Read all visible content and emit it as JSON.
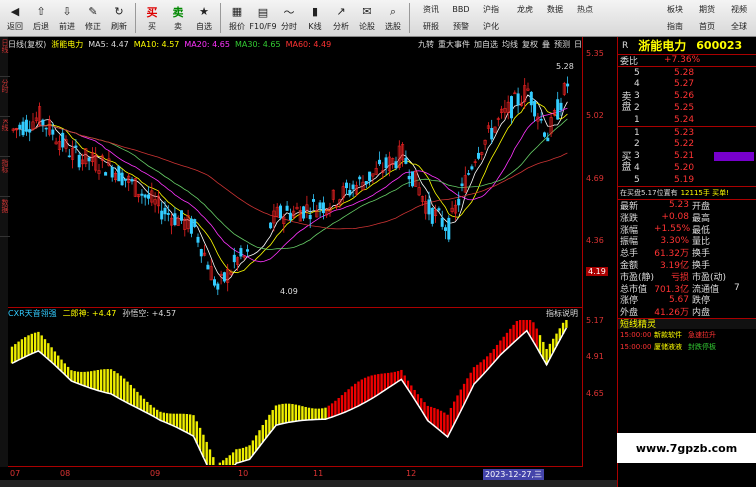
{
  "toolbar": {
    "buttons": [
      "返回",
      "后退",
      "前进",
      "修正",
      "刷新",
      "买",
      "卖",
      "自选",
      "报价",
      "F10/F9",
      "分时",
      "K线",
      "分析",
      "论股",
      "选股"
    ],
    "group": [
      "资讯",
      "BBD",
      "沪指",
      "研报",
      "预警",
      "沪化",
      "龙虎",
      "数据",
      "热点",
      "板块",
      "期货",
      "视频",
      "指南",
      "首页",
      "全球"
    ]
  },
  "left_tabs": [
    "日线",
    "分时",
    "K线",
    "指标",
    "数据"
  ],
  "chart_header": {
    "period": "日线(复权)",
    "stock": "浙能电力",
    "ma5": "MA5: 4.47",
    "ma10": "MA10: 4.57",
    "ma20": "MA20: 4.65",
    "ma30": "MA30: 4.65",
    "ma60": "MA60: 4.49",
    "right_items": [
      "九转",
      "重大事件",
      "加自选",
      "均线",
      "复权",
      "叠",
      "预测",
      "日"
    ]
  },
  "price_labels": {
    "high": "5.28",
    "low": "4.09"
  },
  "indicator_header": {
    "name": "CXR天音翎强",
    "p1": "二郎神: +4.47",
    "p2": "孙悟空: +4.57",
    "help": "指标说明"
  },
  "yaxis_labels": [
    "5.35",
    "5.02",
    "4.69",
    "4.36",
    "4.19",
    "5.17",
    "4.91",
    "4.65"
  ],
  "xaxis_labels": [
    "07",
    "08",
    "09",
    "10",
    "11",
    "12",
    "2023-12-27,三"
  ],
  "side": {
    "code_prefix": "R",
    "name": "浙能电力",
    "code": "600023",
    "ratio_label": "委比",
    "ratio_value": "+7.36%",
    "sell": [
      [
        "5",
        "5.28"
      ],
      [
        "4",
        "5.27"
      ],
      [
        "3",
        "5.26"
      ],
      [
        "2",
        "5.25"
      ],
      [
        "1",
        "5.24"
      ]
    ],
    "buy": [
      [
        "1",
        "5.23"
      ],
      [
        "2",
        "5.22"
      ],
      [
        "3",
        "5.21"
      ],
      [
        "4",
        "5.20"
      ],
      [
        "5",
        "5.19"
      ]
    ],
    "sell_label": "卖盘",
    "buy_label": "买盘",
    "notice": "在买盘5.17位置有",
    "notice2": "12115手 买单!",
    "stats": [
      [
        "最新",
        "5.23",
        "开盘",
        ""
      ],
      [
        "涨跌",
        "+0.08",
        "最高",
        ""
      ],
      [
        "涨幅",
        "+1.55%",
        "最低",
        ""
      ],
      [
        "振幅",
        "3.30%",
        "量比",
        ""
      ],
      [
        "总手",
        "61.32万",
        "换手",
        ""
      ],
      [
        "金额",
        "3.19亿",
        "换手",
        ""
      ],
      [
        "市盈(静)",
        "亏损",
        "市盈(动)",
        ""
      ],
      [
        "总市值",
        "701.3亿",
        "流通值",
        "7"
      ],
      [
        "涨停",
        "5.67",
        "跌停",
        ""
      ],
      [
        "外盘",
        "41.26万",
        "内盘",
        ""
      ]
    ],
    "elf_title": "短线精灵",
    "elf_rows": [
      [
        "15:00:00",
        "新款软件",
        "急速拉升"
      ],
      [
        "15:00:00",
        "厦储液液",
        "封跌停板"
      ]
    ]
  },
  "site_tag": "www.7gpzb.com",
  "chart_data": {
    "type": "candlestick",
    "title": "浙能电力",
    "x_labels": [
      "07",
      "08",
      "09",
      "10",
      "11",
      "12"
    ],
    "ylim": [
      4.09,
      5.35
    ],
    "latest": 5.23,
    "high": 5.28,
    "low": 4.09
  }
}
